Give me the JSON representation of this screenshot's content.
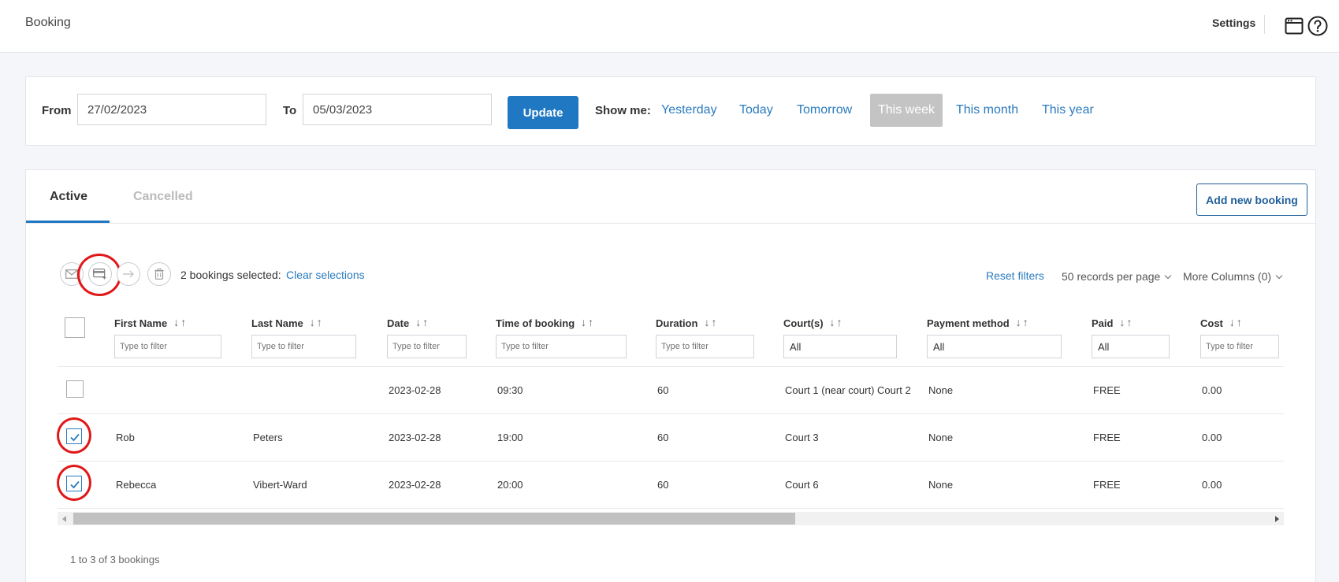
{
  "header": {
    "title": "Booking",
    "settings_label": "Settings"
  },
  "icons": {
    "window": "browser-window-icon",
    "help": "question-circle-icon"
  },
  "filter": {
    "from_label": "From",
    "from_value": "27/02/2023",
    "to_label": "To",
    "to_value": "05/03/2023",
    "update_label": "Update",
    "show_me_label": "Show me:",
    "quick_ranges": [
      "Yesterday",
      "Today",
      "Tomorrow",
      "This week",
      "This month",
      "This year"
    ],
    "active_range": "This week"
  },
  "tabs": {
    "active": "Active",
    "cancelled": "Cancelled"
  },
  "add_booking_label": "Add new booking",
  "toolbar": {
    "selected_text": "2 bookings selected:",
    "clear_label": "Clear selections",
    "reset_filters": "Reset filters",
    "records_per_page": "50 records per page",
    "more_columns": "More Columns (0)"
  },
  "table": {
    "columns": [
      "First Name",
      "Last Name",
      "Date",
      "Time of booking",
      "Duration",
      "Court(s)",
      "Payment method",
      "Paid",
      "Cost"
    ],
    "filter_placeholder": "Type to filter",
    "select_default": "All",
    "rows": [
      {
        "checked": false,
        "first_name": "",
        "last_name": "",
        "date": "2023-02-28",
        "time": "09:30",
        "duration": "60",
        "courts": "Court 1 (near court) Court 2",
        "payment": "None",
        "paid": "FREE",
        "cost": "0.00"
      },
      {
        "checked": true,
        "first_name": "Rob",
        "last_name": "Peters",
        "date": "2023-02-28",
        "time": "19:00",
        "duration": "60",
        "courts": "Court 3",
        "payment": "None",
        "paid": "FREE",
        "cost": "0.00"
      },
      {
        "checked": true,
        "first_name": "Rebecca",
        "last_name": "Vibert-Ward",
        "date": "2023-02-28",
        "time": "20:00",
        "duration": "60",
        "courts": "Court 6",
        "payment": "None",
        "paid": "FREE",
        "cost": "0.00"
      }
    ]
  },
  "footer": {
    "summary": "1 to 3 of 3 bookings"
  },
  "colors": {
    "accent": "#1f78c1",
    "link": "#2b7bbf",
    "highlight_ring": "#e01818"
  }
}
